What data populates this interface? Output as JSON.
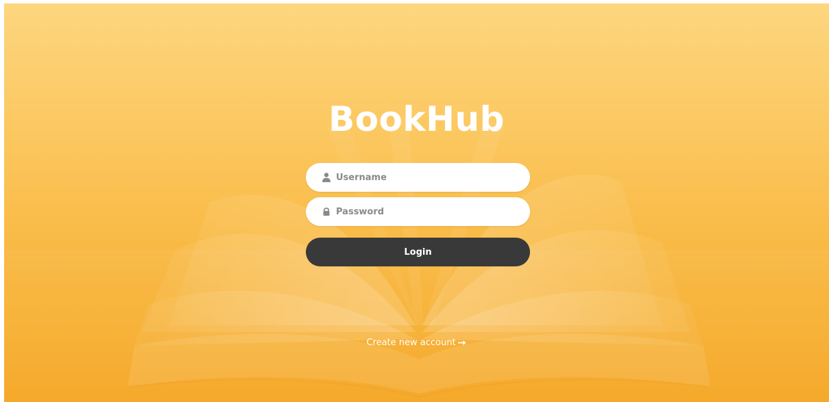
{
  "app": {
    "brand": "BookHub"
  },
  "login_form": {
    "username": {
      "placeholder": "Username",
      "value": "",
      "icon": "user-icon"
    },
    "password": {
      "placeholder": "Password",
      "value": "",
      "icon": "lock-icon"
    },
    "submit_label": "Login"
  },
  "footer": {
    "create_account_label": "Create new account",
    "create_account_icon": "arrow-right-icon"
  },
  "colors": {
    "background_top": "#fdd67e",
    "background_bottom": "#f5a623",
    "button": "#393939",
    "text_on_bg": "#ffffff"
  }
}
